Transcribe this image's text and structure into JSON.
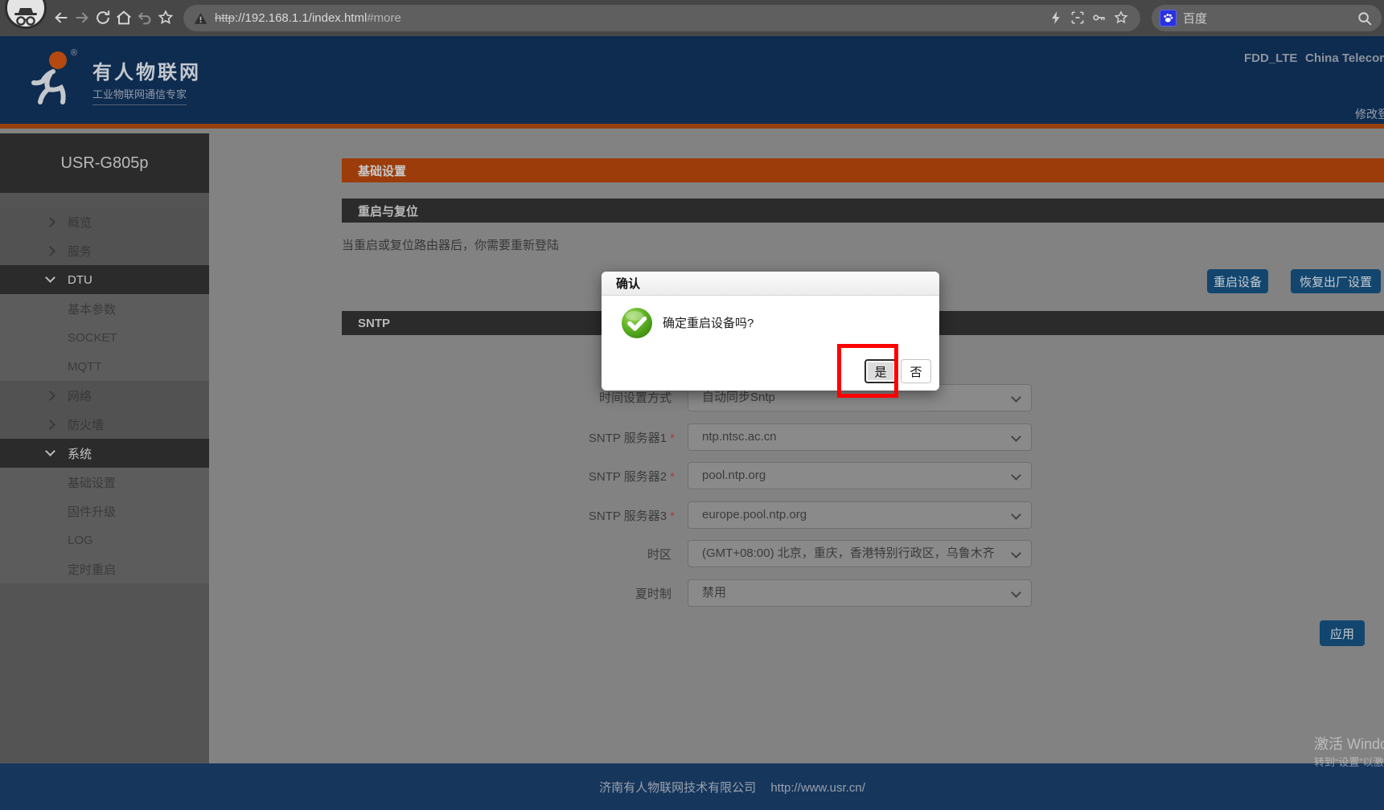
{
  "browser": {
    "url_scheme": "http",
    "url_rest": "://192.168.1.1/index.html",
    "url_fragment": "#more",
    "search_engine": "百度"
  },
  "header": {
    "brand_title": "有人物联网",
    "brand_subtitle": "工业物联网通信专家",
    "network_type": "FDD_LTE",
    "carrier": "China Telecom",
    "change_password": "修改登录密码"
  },
  "sidebar": {
    "device_name": "USR-G805p",
    "items": [
      {
        "label": "概览"
      },
      {
        "label": "服务"
      },
      {
        "label": "DTU"
      },
      {
        "label": "基本参数"
      },
      {
        "label": "SOCKET"
      },
      {
        "label": "MQTT"
      },
      {
        "label": "网络"
      },
      {
        "label": "防火墙"
      },
      {
        "label": "系统"
      },
      {
        "label": "基础设置"
      },
      {
        "label": "固件升级"
      },
      {
        "label": "LOG"
      },
      {
        "label": "定时重启"
      }
    ]
  },
  "main": {
    "page_title": "基础设置",
    "reboot": {
      "title": "重启与复位",
      "note": "当重启或复位路由器后，你需要重新登陆",
      "reboot_button": "重启设备",
      "factory_reset_button": "恢复出厂设置"
    },
    "sntp": {
      "title": "SNTP",
      "rows": [
        {
          "label": "时间设置方式",
          "star": "",
          "value": "自动同步Sntp"
        },
        {
          "label": "SNTP 服务器1",
          "star": "*",
          "value": "ntp.ntsc.ac.cn"
        },
        {
          "label": "SNTP 服务器2",
          "star": "*",
          "value": "pool.ntp.org"
        },
        {
          "label": "SNTP 服务器3",
          "star": "*",
          "value": "europe.pool.ntp.org"
        },
        {
          "label": "时区",
          "star": "",
          "value": "(GMT+08:00) 北京，重庆，香港特别行政区，乌鲁木齐"
        },
        {
          "label": "夏时制",
          "star": "",
          "value": "禁用"
        }
      ],
      "apply_button": "应用"
    }
  },
  "dialog": {
    "title": "确认",
    "message": "确定重启设备吗?",
    "yes_button": "是",
    "no_button": "否"
  },
  "footer": {
    "company": "济南有人物联网技术有限公司",
    "url": "http://www.usr.cn/"
  },
  "watermark": {
    "line1": "激活 Windows",
    "line2": "转到“设置”以激活 Windows。"
  },
  "colors": {
    "accent_orange": "#9c3c0a",
    "header_navy": "#0e2c50",
    "button_blue": "#12466e",
    "highlight_red": "#fe0000",
    "dialog_green": "#58a317"
  }
}
